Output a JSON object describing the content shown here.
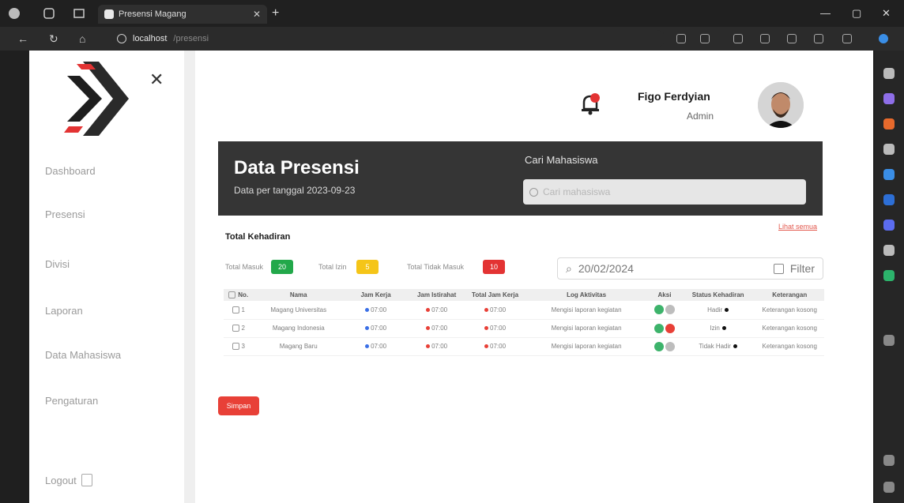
{
  "browser": {
    "tab_title": "Presensi Magang",
    "url_host": "localhost",
    "url_path": "/presensi"
  },
  "sidebar": {
    "items": [
      {
        "label": "Dashboard"
      },
      {
        "label": "Presensi"
      },
      {
        "label": "Divisi"
      },
      {
        "label": "Laporan"
      },
      {
        "label": "Data Mahasiswa"
      },
      {
        "label": "Pengaturan"
      }
    ],
    "logout_label": "Logout"
  },
  "header": {
    "user_name": "Figo Ferdyian",
    "user_role": "Admin"
  },
  "hero": {
    "title": "Data Presensi",
    "subtitle": "Data per tanggal 2023-09-23",
    "search_label": "Cari Mahasiswa",
    "search_placeholder": "Cari mahasiswa"
  },
  "summary": {
    "title": "Total Kehadiran",
    "refresh_link": "Lihat semua",
    "chips": [
      {
        "label": "Total Masuk",
        "value": "20",
        "color": "#22a84a"
      },
      {
        "label": "Total Izin",
        "value": "5",
        "color": "#f5c518"
      },
      {
        "label": "Total Tidak Masuk",
        "value": "10",
        "color": "#e33333"
      }
    ]
  },
  "filter": {
    "date_value": "20/02/2024",
    "filter_label": "Filter"
  },
  "table": {
    "headers": [
      "No.",
      "Nama",
      "Jam Kerja",
      "Jam Istirahat",
      "Total Jam Kerja",
      "Log Aktivitas",
      "Aksi",
      "Status Kehadiran",
      "Keterangan"
    ],
    "rows": [
      {
        "no": "1",
        "name": "Magang Universitas",
        "status": "Hadir",
        "note": "Keterangan kosong",
        "aksi_colors": [
          "#3db36b",
          "#bdbdbd"
        ]
      },
      {
        "no": "2",
        "name": "Magang Indonesia",
        "status": "Izin",
        "note": "Keterangan kosong",
        "aksi_colors": [
          "#3db36b",
          "#e84037"
        ]
      },
      {
        "no": "3",
        "name": "Magang Baru",
        "status": "Tidak Hadir",
        "note": "Keterangan kosong",
        "aksi_colors": [
          "#3db36b",
          "#bdbdbd"
        ]
      }
    ],
    "cell_time": "07:00",
    "cell_activity": "Mengisi laporan kegiatan"
  },
  "actions": {
    "save_label": "Simpan"
  }
}
